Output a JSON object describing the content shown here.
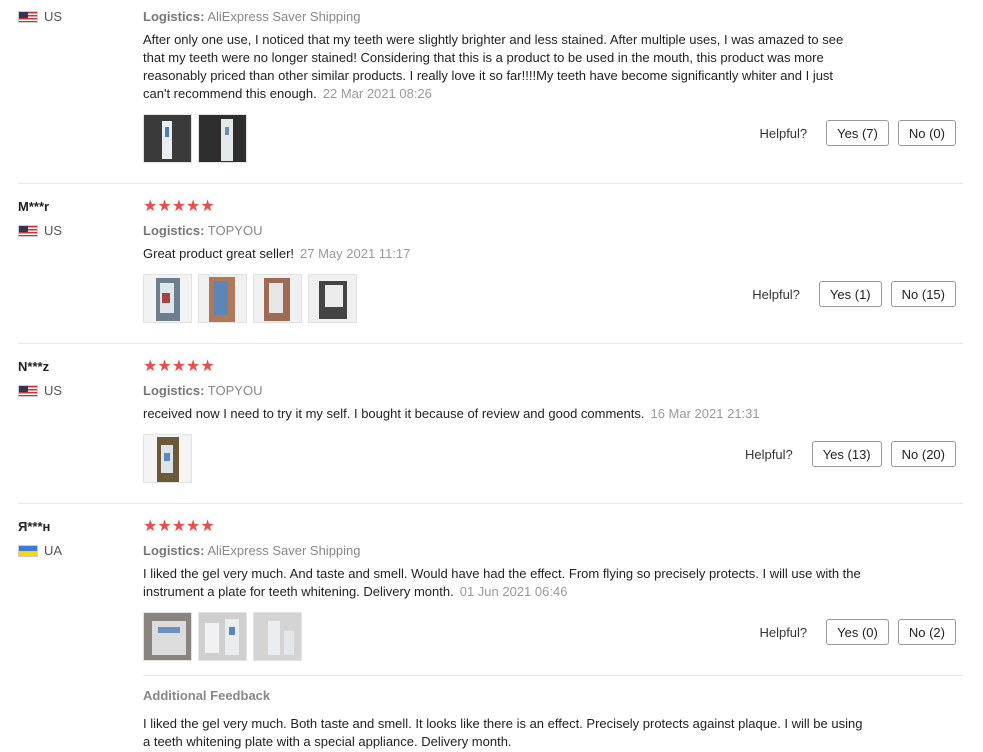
{
  "helpful_label": "Helpful?",
  "logistics_label": "Logistics:",
  "star_glyphs": "★★★★★",
  "reviews": [
    {
      "country": "US",
      "logistics": "AliExpress Saver Shipping",
      "text": "After only one use, I noticed that my teeth were slightly brighter and less stained. After multiple uses, I was amazed to see that my teeth were no longer stained! Considering that this is a product to be used in the mouth, this product was more reasonably priced than other similar products. I really love it so far!!!!My teeth have become significantly whiter and I just can't recommend this enough.",
      "date": "22 Mar 2021 08:26",
      "yes": "Yes (7)",
      "no": "No (0)"
    },
    {
      "user": "M***r",
      "country": "US",
      "logistics": "TOPYOU",
      "text": "Great product great seller!",
      "date": "27 May 2021 11:17",
      "yes": "Yes (1)",
      "no": "No (15)"
    },
    {
      "user": "N***z",
      "country": "US",
      "logistics": "TOPYOU",
      "text": "received now I need to try it my self. I bought it because of review and good comments.",
      "date": "16 Mar 2021 21:31",
      "yes": "Yes (13)",
      "no": "No (20)"
    },
    {
      "user": "Я***н",
      "country": "UA",
      "logistics": "AliExpress Saver Shipping",
      "text": "I liked the gel very much. And taste and smell. Would have had the effect. From flying so precisely protects. I will use with the instrument a plate for teeth whitening. Delivery month.",
      "date": "01 Jun 2021 06:46",
      "yes": "Yes (0)",
      "no": "No (2)",
      "additional_title": "Additional Feedback",
      "additional_text": "I liked the gel very much. Both taste and smell. It looks like there is an effect. Precisely protects against plaque. I will be using a teeth whitening plate with a special appliance. Delivery month."
    }
  ]
}
